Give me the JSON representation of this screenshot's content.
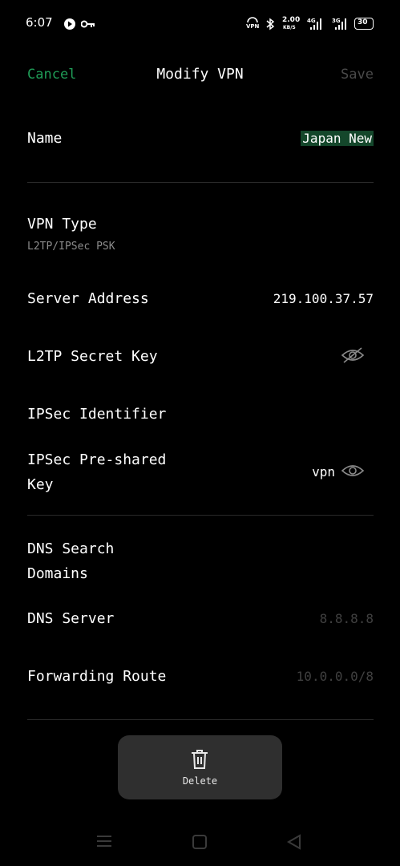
{
  "status_bar": {
    "time": "6:07",
    "net_speed_value": "2.00",
    "net_speed_unit": "KB/S",
    "net_label_1": "4G",
    "net_label_2": "3G",
    "battery": "30",
    "vpn_label": "VPN"
  },
  "header": {
    "cancel_label": "Cancel",
    "title": "Modify VPN",
    "save_label": "Save",
    "accent_color": "#1f9c57"
  },
  "form": {
    "name": {
      "label": "Name",
      "value": "Japan New"
    },
    "vpn_type": {
      "label": "VPN Type",
      "value": "L2TP/IPSec PSK"
    },
    "server_address": {
      "label": "Server Address",
      "value": "219.100.37.57"
    },
    "l2tp_secret": {
      "label": "L2TP Secret Key",
      "icon": "eye-off-icon"
    },
    "ipsec_identifier": {
      "label": "IPSec Identifier"
    },
    "ipsec_psk": {
      "label_line1": "IPSec Pre-shared",
      "label_line2": "Key",
      "value": "vpn",
      "icon": "eye-icon"
    },
    "dns_search": {
      "label_line1": "DNS Search",
      "label_line2": "Domains"
    },
    "dns_server": {
      "label": "DNS Server",
      "placeholder": "8.8.8.8"
    },
    "forwarding_route": {
      "label": "Forwarding Route",
      "placeholder": "10.0.0.0/8"
    }
  },
  "popup": {
    "delete_label": "Delete",
    "icon": "trash-icon"
  },
  "nav_bar": {
    "icons": [
      "menu-icon",
      "home-square-icon",
      "back-triangle-icon"
    ]
  }
}
